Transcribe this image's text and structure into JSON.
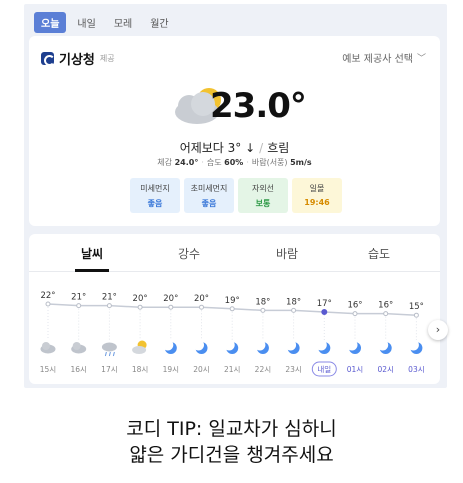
{
  "day_tabs": [
    {
      "label": "오늘",
      "active": true
    },
    {
      "label": "내일",
      "active": false
    },
    {
      "label": "모레",
      "active": false
    },
    {
      "label": "월간",
      "active": false
    }
  ],
  "provider": {
    "name": "기상청",
    "sub": "제공",
    "select_label": "예보 제공사 선택"
  },
  "current": {
    "temperature": "23.0°",
    "compare_label": "어제보다 3° ↓",
    "condition": "흐림",
    "feels_label": "체감",
    "feels_value": "24.0°",
    "humidity_label": "습도",
    "humidity_value": "60%",
    "wind_label": "바람(서풍)",
    "wind_value": "5m/s",
    "icon": "cloud-sun-icon"
  },
  "badges": [
    {
      "title": "미세먼지",
      "value": "좋음",
      "tone": "blue"
    },
    {
      "title": "초미세먼지",
      "value": "좋음",
      "tone": "blue"
    },
    {
      "title": "자외선",
      "value": "보통",
      "tone": "green"
    },
    {
      "title": "일몰",
      "value": "19:46",
      "tone": "yellow"
    }
  ],
  "hourly_tabs": [
    {
      "label": "날씨",
      "active": true
    },
    {
      "label": "강수",
      "active": false
    },
    {
      "label": "바람",
      "active": false
    },
    {
      "label": "습도",
      "active": false
    }
  ],
  "chart_data": {
    "type": "line",
    "x": [
      "15시",
      "16시",
      "17시",
      "18시",
      "19시",
      "20시",
      "21시",
      "22시",
      "23시",
      "내일",
      "01시",
      "02시",
      "03시"
    ],
    "temps": [
      22,
      21,
      21,
      20,
      20,
      20,
      19,
      18,
      18,
      17,
      16,
      16,
      15
    ],
    "temp_labels": [
      "22°",
      "21°",
      "21°",
      "20°",
      "20°",
      "20°",
      "19°",
      "18°",
      "18°",
      "17°",
      "16°",
      "16°",
      "15°"
    ],
    "icons": [
      "cloud-icon",
      "cloud-icon",
      "rain-cloud-icon",
      "partly-sunny-icon",
      "moon-icon",
      "moon-icon",
      "moon-icon",
      "moon-icon",
      "moon-icon",
      "moon-icon",
      "moon-icon",
      "moon-icon",
      "moon-icon"
    ],
    "highlight": "내일"
  },
  "next_button": "›",
  "tip_lines": [
    "코디 TIP: 일교차가 심하니",
    "얇은 가디건을 챙겨주세요"
  ],
  "colors": {
    "accent": "#5b7fd6",
    "moon": "#4a8ef0",
    "night_label": "#5a5ad0"
  }
}
